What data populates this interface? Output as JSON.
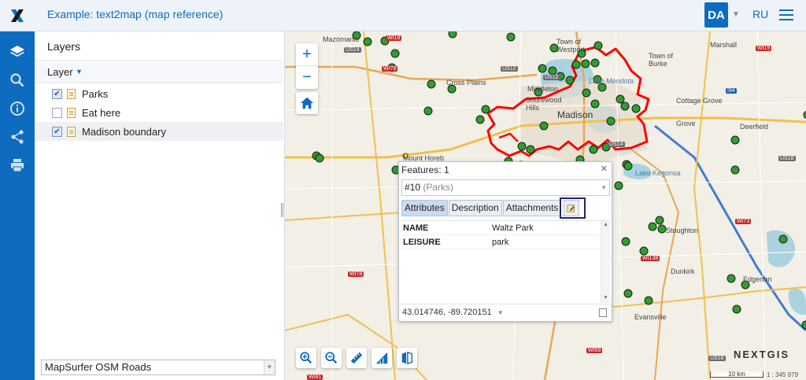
{
  "header": {
    "title": "Example: text2map (map reference)",
    "lang_active": "DA",
    "lang_other": "RU"
  },
  "rail": {
    "items": [
      "layers-icon",
      "search-icon",
      "info-icon",
      "share-icon",
      "print-icon"
    ]
  },
  "panel": {
    "title": "Layers",
    "column_header": "Layer",
    "layers": [
      {
        "name": "Parks",
        "checked": true
      },
      {
        "name": "Eat here",
        "checked": false
      },
      {
        "name": "Madison boundary",
        "checked": true
      }
    ],
    "basemap": "MapSurfer OSM Roads"
  },
  "map": {
    "labels": [
      "Mazomanie",
      "Town of Westport",
      "Town of Burke",
      "Marshall",
      "Cross Plains",
      "Middleton",
      "Shorewood Hills",
      "Madison",
      "Cottage Grove",
      "Grove",
      "Deerfield",
      "Mount Horeb",
      "Lake Kegonsa",
      "Stoughton",
      "Dunkirk",
      "Edgerton",
      "Evansville",
      "Lake Mendota"
    ],
    "shields": [
      "WI19",
      "US14",
      "WI78",
      "US12",
      "WI19",
      "US12",
      "US18",
      "WI73",
      "WI138",
      "WI78",
      "WI59",
      "WI81",
      "US14",
      "US18",
      "I94"
    ],
    "attribution": "NEXTGIS",
    "scale_label": "10 km",
    "scale_ratio": "1 : 345 979"
  },
  "popup": {
    "title": "Features: 1",
    "feature_id": "#10",
    "feature_layer": "(Parks)",
    "tabs": [
      "Attributes",
      "Description",
      "Attachments"
    ],
    "attributes": [
      {
        "key": "NAME",
        "value": "Waltz Park"
      },
      {
        "key": "LEISURE",
        "value": "park"
      }
    ],
    "coords": "43.014746, -89.720151"
  },
  "colors": {
    "brand": "#0d6cbf",
    "park_marker": "#2e9e2e",
    "boundary": "#ff0000"
  }
}
